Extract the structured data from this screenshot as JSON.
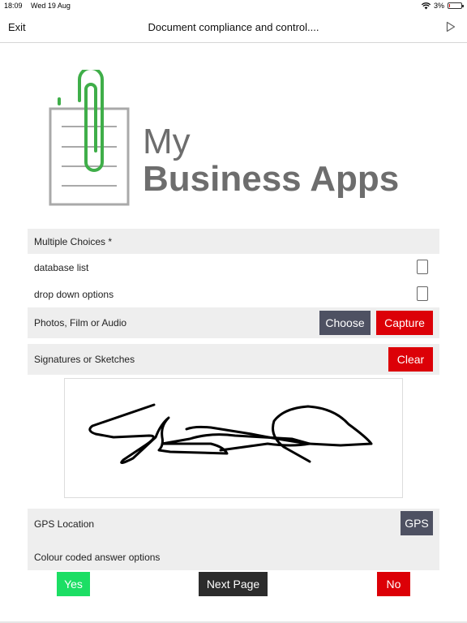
{
  "status_bar": {
    "time": "18:09",
    "date": "Wed 19 Aug",
    "battery": "3%",
    "icons": [
      "wifi-icon",
      "battery-icon"
    ]
  },
  "nav": {
    "exit_label": "Exit",
    "title": "Document compliance and control....",
    "forward_icon": "play-arrow-icon"
  },
  "logo": {
    "line1": "My",
    "line2": "Business Apps",
    "color_green": "#3fae49",
    "color_gray": "#6d6d6d",
    "icon": "clipboard-paperclip-icon"
  },
  "multiple_choices": {
    "header": "Multiple Choices *",
    "options": [
      {
        "label": "database list",
        "checked": false
      },
      {
        "label": "drop down options",
        "checked": false
      }
    ]
  },
  "media": {
    "label": "Photos, Film or Audio",
    "choose_label": "Choose",
    "capture_label": "Capture"
  },
  "signature": {
    "label": "Signatures or Sketches",
    "clear_label": "Clear"
  },
  "gps": {
    "label": "GPS Location",
    "button_label": "GPS"
  },
  "colour_options": {
    "label": "Colour coded answer options"
  },
  "footer": {
    "yes_label": "Yes",
    "next_label": "Next Page",
    "no_label": "No"
  },
  "colors": {
    "dark_button": "#4e5162",
    "red_button": "#dc0007",
    "green_button": "#1cde64",
    "section_gray": "#eeeeee"
  }
}
